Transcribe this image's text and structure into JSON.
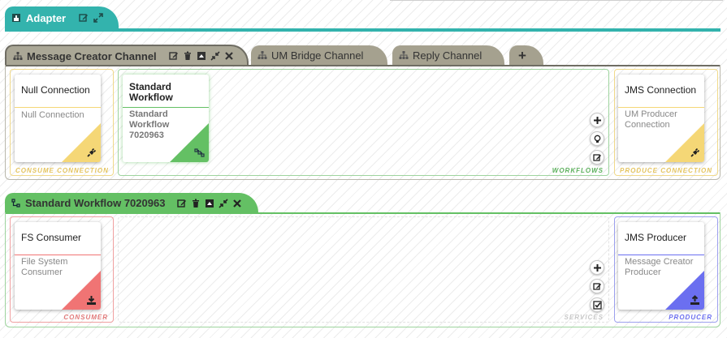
{
  "adapter": {
    "title": "Adapter",
    "icon": "adapter-icon"
  },
  "channel_tabs": [
    {
      "label": "Message Creator Channel",
      "active": true
    },
    {
      "label": "UM Bridge Channel",
      "active": false
    },
    {
      "label": "Reply Channel",
      "active": false
    }
  ],
  "add_tab_label": "+",
  "channel": {
    "consume": {
      "section_label": "CONSUME CONNECTION",
      "card_title": "Null Connection",
      "card_subtitle": "Null Connection",
      "color": "#f5d776",
      "icon": "plug-icon"
    },
    "workflows": {
      "section_label": "WORKFLOWS",
      "card_title_line1": "Standard",
      "card_title_line2": "Workflow",
      "card_sub_line1": "Standard",
      "card_sub_line2": "Workflow",
      "card_sub_line3": "7020963",
      "color": "#64c064",
      "icon": "workflow-icon"
    },
    "produce": {
      "section_label": "PRODUCE CONNECTION",
      "card_title": "JMS Connection",
      "card_sub_line1": "UM Producer",
      "card_sub_line2": "Connection",
      "color": "#f5d776",
      "icon": "plug-icon"
    }
  },
  "workflow": {
    "tab_title": "Standard Workflow 7020963",
    "consumer": {
      "section_label": "CONSUMER",
      "card_title": "FS Consumer",
      "card_sub_line1": "File System",
      "card_sub_line2": "Consumer",
      "color": "#f07474",
      "icon": "download-icon"
    },
    "services": {
      "section_label": "SERVICES"
    },
    "producer": {
      "section_label": "PRODUCER",
      "card_title": "JMS Producer",
      "card_sub_line1": "Message Creator",
      "card_sub_line2": "Producer",
      "color": "#6b6ff0",
      "icon": "upload-icon"
    }
  },
  "colors": {
    "adapter": "#33b3ad",
    "channel": "#aaa796",
    "workflow": "#64c064",
    "consume_border": "#f0d98a",
    "produce_border": "#f0d98a",
    "workflows_border": "#9ed49e",
    "consumer_border": "#f0a0a0",
    "producer_border": "#9ca0ee"
  }
}
